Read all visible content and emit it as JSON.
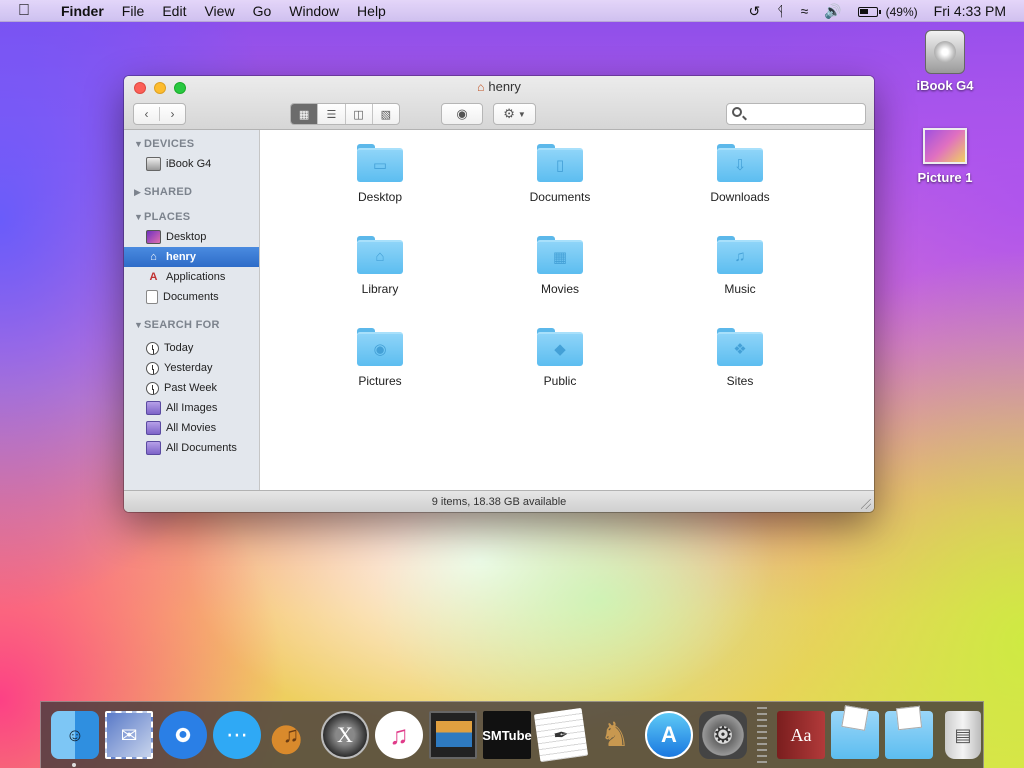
{
  "menubar": {
    "apple_icon": "apple-icon",
    "items": [
      "Finder",
      "File",
      "Edit",
      "View",
      "Go",
      "Window",
      "Help"
    ],
    "battery": "(49%)",
    "clock": "Fri 4:33 PM"
  },
  "desktop": {
    "icons": [
      {
        "label": "iBook G4",
        "icon": "hard-disk-icon"
      },
      {
        "label": "Picture 1",
        "icon": "image-file-icon"
      }
    ]
  },
  "window": {
    "title": "henry",
    "search": {
      "value": "",
      "placeholder": ""
    },
    "sidebar": {
      "devices_header": "DEVICES",
      "devices": [
        "iBook G4"
      ],
      "shared_header": "SHARED",
      "places_header": "PLACES",
      "places": [
        "Desktop",
        "henry",
        "Applications",
        "Documents"
      ],
      "selected_place": "henry",
      "search_header": "SEARCH FOR",
      "searches": [
        "Today",
        "Yesterday",
        "Past Week",
        "All Images",
        "All Movies",
        "All Documents"
      ]
    },
    "items": [
      {
        "name": "Desktop",
        "icon": "desktop-folder-icon"
      },
      {
        "name": "Documents",
        "icon": "documents-folder-icon"
      },
      {
        "name": "Downloads",
        "icon": "downloads-folder-icon"
      },
      {
        "name": "Library",
        "icon": "library-folder-icon"
      },
      {
        "name": "Movies",
        "icon": "movies-folder-icon"
      },
      {
        "name": "Music",
        "icon": "music-folder-icon"
      },
      {
        "name": "Pictures",
        "icon": "pictures-folder-icon"
      },
      {
        "name": "Public",
        "icon": "public-folder-icon"
      },
      {
        "name": "Sites",
        "icon": "sites-folder-icon"
      }
    ],
    "status": "9 items, 18.38 GB available"
  },
  "dock": {
    "apps": [
      "Finder",
      "Mail",
      "Adium",
      "Messages",
      "GarageBand",
      "Mac OS X",
      "iTunes",
      "Photo Booth",
      "SMTube",
      "TextEdit",
      "Chess",
      "App Store",
      "System Preferences"
    ],
    "smtube_label": "SMTube",
    "dictionary_label": "Aa"
  },
  "colors": {
    "selection": "#2e6cc8",
    "folder": "#5cbdf0",
    "close": "#fc5f57",
    "minimize": "#fdbc2e",
    "zoom": "#28c840"
  }
}
